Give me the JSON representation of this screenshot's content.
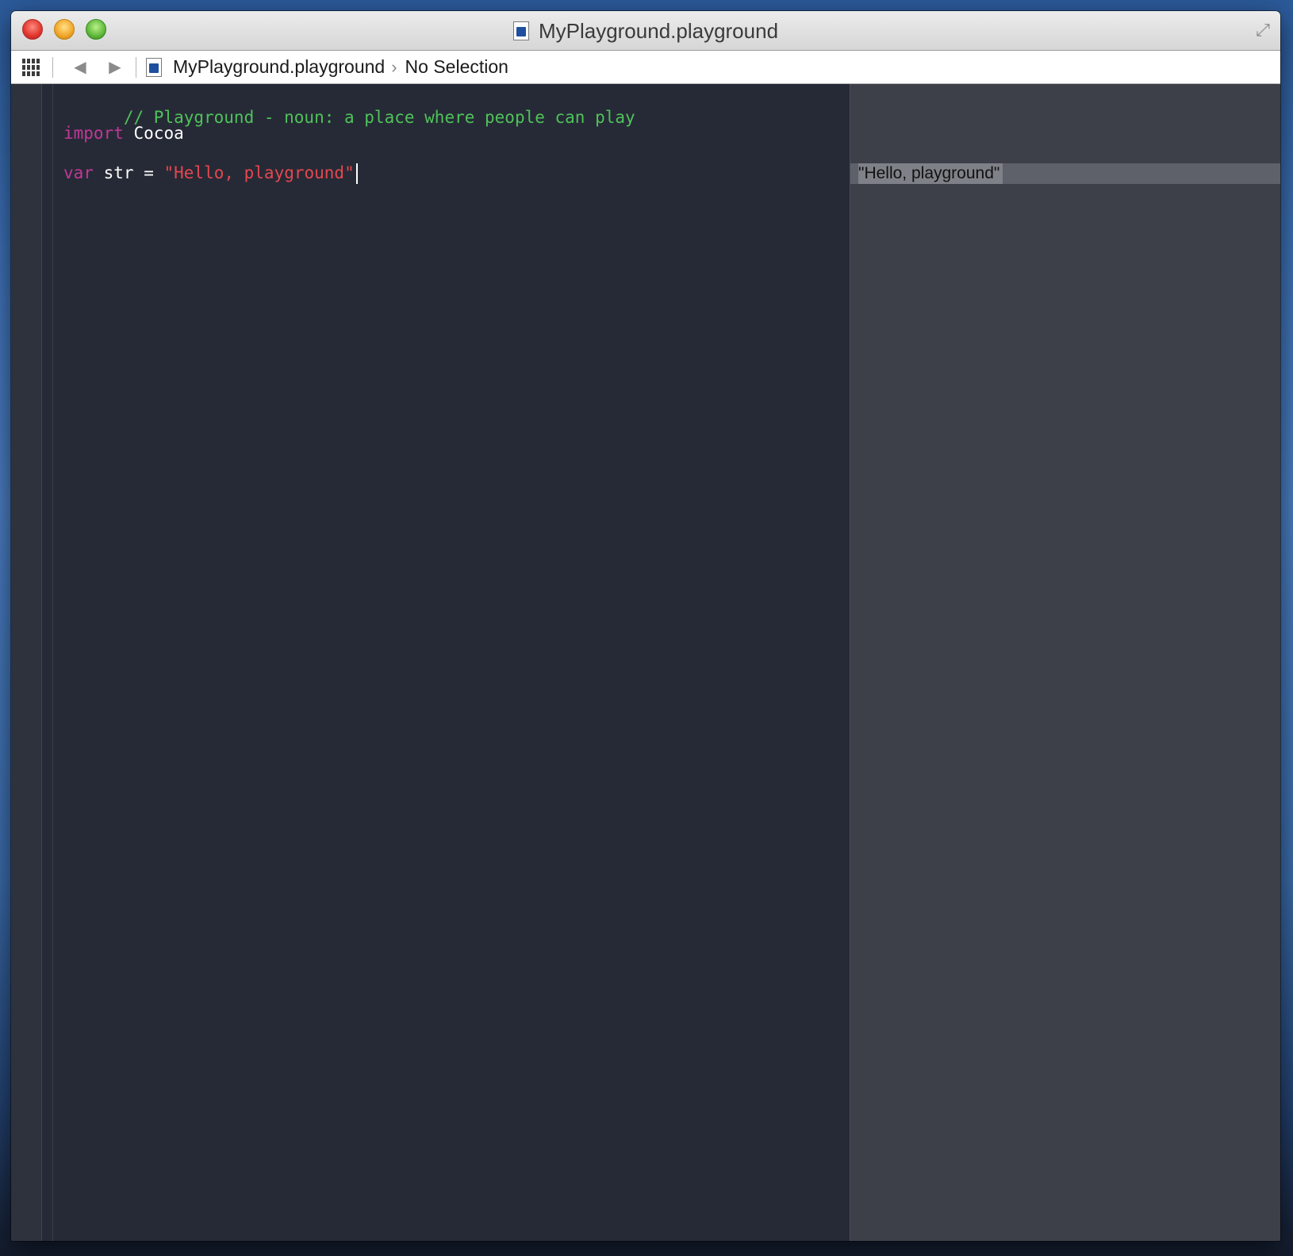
{
  "window": {
    "title": "MyPlayground.playground"
  },
  "jumpbar": {
    "file_name": "MyPlayground.playground",
    "selection": "No Selection"
  },
  "editor": {
    "comment": "// Playground - noun: a place where people can play",
    "import_keyword": "import",
    "import_module": "Cocoa",
    "var_keyword": "var",
    "var_name": "str",
    "assign_op": "=",
    "string_literal": "\"Hello, playground\""
  },
  "results": {
    "line3_value": "\"Hello, playground\""
  },
  "colors": {
    "comment": "#4fc25a",
    "keyword": "#c23797",
    "string": "#e5474e",
    "editor_bg": "#262a36",
    "results_bg": "#3d4049"
  },
  "icons": {
    "close": "close-icon",
    "minimize": "minimize-icon",
    "zoom": "zoom-icon",
    "file": "playground-file-icon",
    "fullscreen": "fullscreen-icon",
    "related_items": "grid-icon",
    "back": "back-arrow-icon",
    "forward": "forward-arrow-icon"
  }
}
